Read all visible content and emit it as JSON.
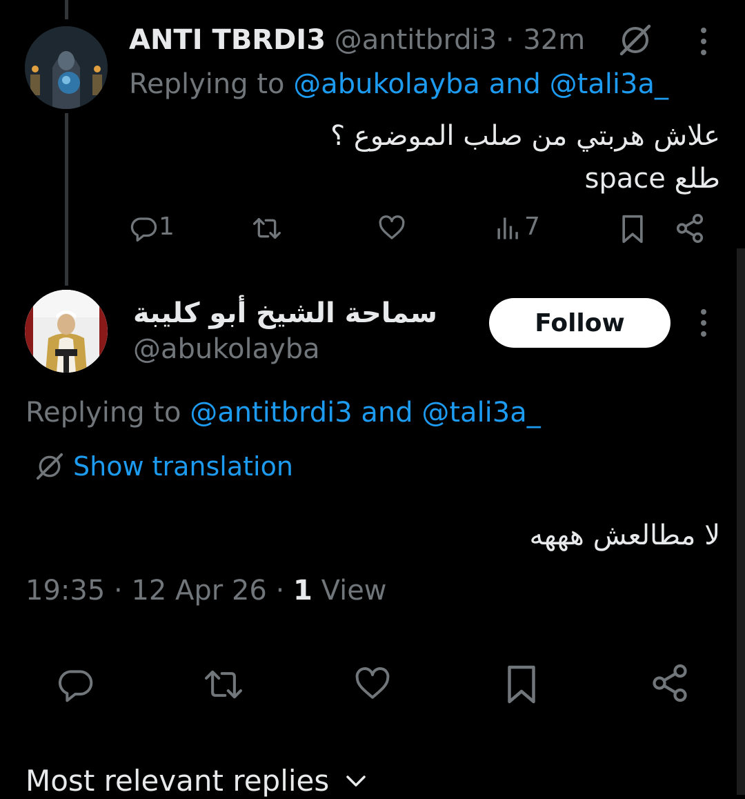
{
  "parent_tweet": {
    "display_name": "ANTI TBRDI3",
    "handle": "@antitbrdi3",
    "separator": " · ",
    "time": "32m",
    "replying_prefix": "Replying to ",
    "reply_user_1": "@abukolayba",
    "reply_and": " and ",
    "reply_user_2": "@tali3a_",
    "text_line_1": "علاش هربتي من صلب الموضوع ؟",
    "text_line_2": "طلع space",
    "reply_count": "1",
    "view_count": "7",
    "icons": [
      "grok-icon",
      "more-icon",
      "reply-icon",
      "retweet-icon",
      "like-icon",
      "views-icon",
      "bookmark-icon",
      "share-icon"
    ]
  },
  "main_tweet": {
    "display_name": "سماحة الشيخ أبو كليبة",
    "handle": "@abukolayba",
    "follow_label": "Follow",
    "replying_prefix": "Replying to ",
    "reply_user_1": "@antitbrdi3",
    "reply_and": " and ",
    "reply_user_2": "@tali3a_",
    "translate_label": "Show translation",
    "text": "لا مطالعش هههه",
    "time": "19:35",
    "date": "12 Apr 26",
    "sep": " · ",
    "view_number": "1",
    "view_label": " View"
  },
  "replies_sort": {
    "label": "Most relevant replies"
  },
  "colors": {
    "background": "#000000",
    "text": "#e7e9ea",
    "muted": "#71767b",
    "link": "#1d9bf0",
    "thread_line": "#333639"
  }
}
